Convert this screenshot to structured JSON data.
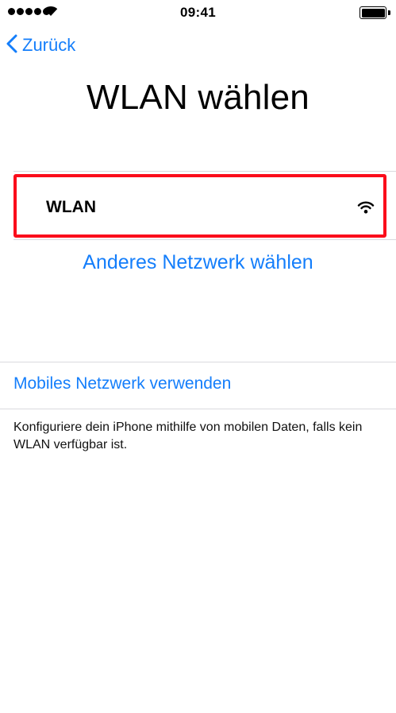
{
  "status_bar": {
    "time": "09:41",
    "signal_icon": "signal-dots-icon",
    "wifi_icon": "wifi-icon",
    "battery_icon": "battery-full-icon"
  },
  "nav": {
    "back_label": "Zurück",
    "back_icon": "chevron-left-icon"
  },
  "title": "WLAN wählen",
  "networks": [
    {
      "name": "WLAN",
      "icon": "wifi-icon"
    }
  ],
  "other_network_label": "Anderes Netzwerk wählen",
  "mobile_network_label": "Mobiles Netzwerk verwenden",
  "footer_text": "Konfiguriere dein iPhone mithilfe von mobilen Daten, falls kein WLAN verfügbar ist.",
  "colors": {
    "accent": "#147efb",
    "highlight": "#fb0d1b",
    "separator": "#d9d9de"
  }
}
